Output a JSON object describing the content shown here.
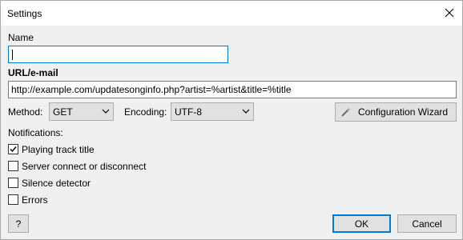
{
  "window": {
    "title": "Settings",
    "close_glyph": "✕"
  },
  "name_field": {
    "label": "Name",
    "value": ""
  },
  "url_field": {
    "label": "URL/e-mail",
    "value": "http://example.com/updatesonginfo.php?artist=%artist&title=%title"
  },
  "method": {
    "label": "Method:",
    "selected": "GET"
  },
  "encoding": {
    "label": "Encoding:",
    "selected": "UTF-8"
  },
  "wizard_button": {
    "label": "Configuration Wizard",
    "icon": "wand-icon"
  },
  "notifications": {
    "label": "Notifications:",
    "items": [
      {
        "label": "Playing track title",
        "checked": true
      },
      {
        "label": "Server connect or disconnect",
        "checked": false
      },
      {
        "label": "Silence detector",
        "checked": false
      },
      {
        "label": "Errors",
        "checked": false
      }
    ]
  },
  "footer": {
    "help_label": "?",
    "ok_label": "OK",
    "cancel_label": "Cancel"
  },
  "colors": {
    "accent": "#0078d7",
    "button_bg": "#e1e1e1",
    "dialog_bg": "#f0f0f0"
  }
}
